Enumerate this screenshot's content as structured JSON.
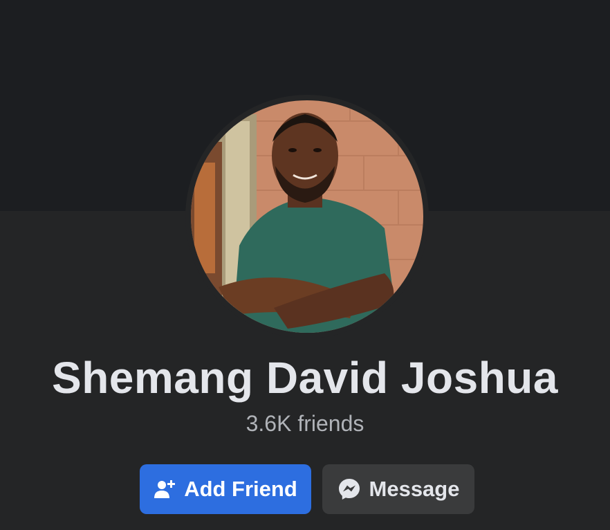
{
  "profile": {
    "name": "Shemang David Joshua",
    "friends": "3.6K friends"
  },
  "actions": {
    "add_friend_label": "Add Friend",
    "message_label": "Message"
  },
  "colors": {
    "background": "#242526",
    "cover": "#1c1e21",
    "primary_button": "#2d6ee0",
    "secondary_button": "#3a3b3c",
    "text_primary": "#e4e6eb",
    "text_secondary": "#b0b3b8"
  },
  "icons": {
    "add_friend": "user-plus-icon",
    "message": "messenger-icon"
  }
}
